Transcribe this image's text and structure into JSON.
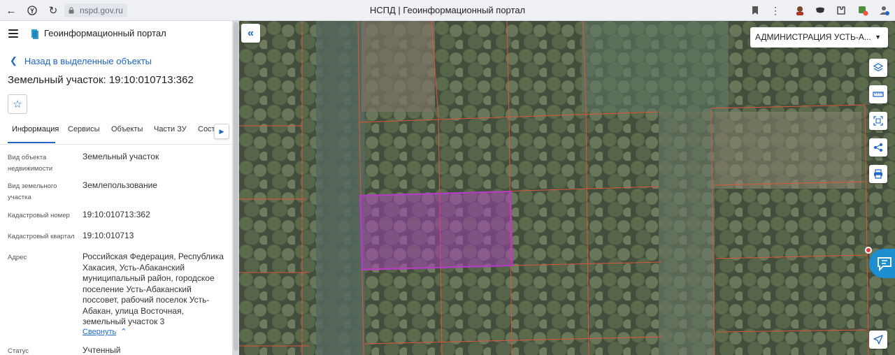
{
  "browser": {
    "url": "nspd.gov.ru",
    "title": "НСПД | Геоинформационный портал"
  },
  "panel": {
    "app_name": "Геоинформационный портал",
    "back_label": "Назад в выделенные объекты",
    "object_title": "Земельный участок: 19:10:010713:362",
    "tabs": [
      {
        "label": "Информация",
        "active": true
      },
      {
        "label": "Сервисы"
      },
      {
        "label": "Объекты"
      },
      {
        "label": "Части ЗУ"
      },
      {
        "label": "Соста"
      }
    ],
    "fields": [
      {
        "label": "Вид объекта недвижимости",
        "value": "Земельный участок"
      },
      {
        "label": "Вид земельного участка",
        "value": "Землепользование"
      },
      {
        "label": "Кадастровый номер",
        "value": "19:10:010713:362"
      },
      {
        "label": "Кадастровый квартал",
        "value": "19:10:010713"
      },
      {
        "label": "Адрес",
        "value": "Российская Федерация, Республика Хакасия, Усть-Абаканский муниципальный район, городское поселение Усть-Абаканский поссовет, рабочий поселок Усть-Абакан, улица Восточная, земельный участок 3"
      },
      {
        "label": "Статус",
        "value": "Учтенный"
      }
    ],
    "collapse_label": "Свернуть"
  },
  "map": {
    "admin_select": "АДМИНИСТРАЦИЯ УСТЬ-А...",
    "selected_color": "#b43cc8",
    "boundary_color": "#d9583e",
    "tools": [
      "layers-icon",
      "ruler-icon",
      "select-area-icon",
      "share-icon",
      "print-icon"
    ]
  }
}
